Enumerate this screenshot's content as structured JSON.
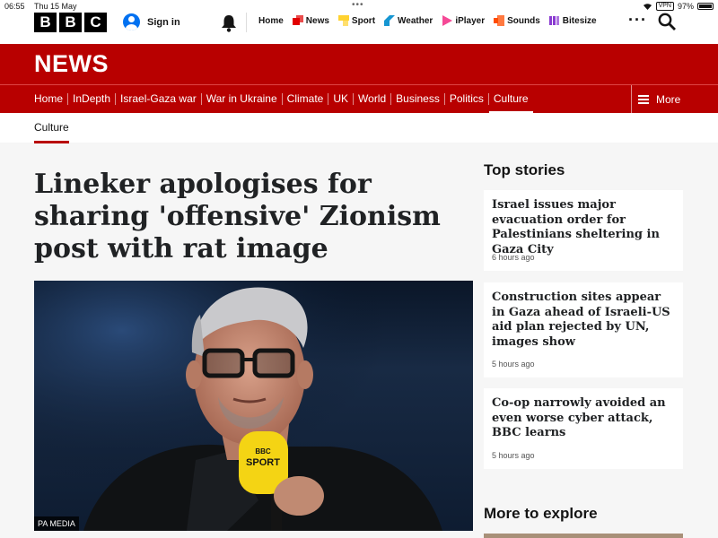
{
  "status": {
    "time": "06:55",
    "date": "Thu 15 May",
    "vpn": "VPN",
    "battery": "97%"
  },
  "header": {
    "logo_letters": [
      "B",
      "B",
      "C"
    ],
    "sign_in": "Sign in",
    "nav": [
      {
        "label": "Home",
        "icon": "none"
      },
      {
        "label": "News",
        "icon": "news-icon",
        "color": "#e10000"
      },
      {
        "label": "Sport",
        "icon": "sport-icon",
        "color": "#ffd230"
      },
      {
        "label": "Weather",
        "icon": "weather-icon",
        "color": "#1696d2"
      },
      {
        "label": "iPlayer",
        "icon": "iplayer-icon",
        "color": "#f54996"
      },
      {
        "label": "Sounds",
        "icon": "sounds-icon",
        "color": "#ff4c00"
      },
      {
        "label": "Bitesize",
        "icon": "bitesize-icon",
        "color": "#8a3bd1"
      }
    ]
  },
  "banner": {
    "title": "NEWS"
  },
  "sections": {
    "items": [
      "Home",
      "InDepth",
      "Israel-Gaza war",
      "War in Ukraine",
      "Climate",
      "UK",
      "World",
      "Business",
      "Politics",
      "Culture"
    ],
    "active": "Culture",
    "more": "More"
  },
  "subnav": {
    "active_tab": "Culture"
  },
  "article": {
    "headline": "Lineker apologises for sharing 'offensive' Zionism post with rat image",
    "image_credit": "PA MEDIA",
    "mic_text": "BBC SPORT"
  },
  "sidebar": {
    "top_stories_heading": "Top stories",
    "stories": [
      {
        "title": "Israel issues major evacuation order for Palestinians sheltering in Gaza City",
        "time": "6 hours ago"
      },
      {
        "title": "Construction sites appear in Gaza ahead of Israeli-US aid plan rejected by UN, images show",
        "time": "5 hours ago"
      },
      {
        "title": "Co-op narrowly avoided an even worse cyber attack, BBC learns",
        "time": "5 hours ago"
      }
    ],
    "more_heading": "More to explore"
  },
  "colors": {
    "brand_red": "#b80000",
    "text": "#141414"
  }
}
